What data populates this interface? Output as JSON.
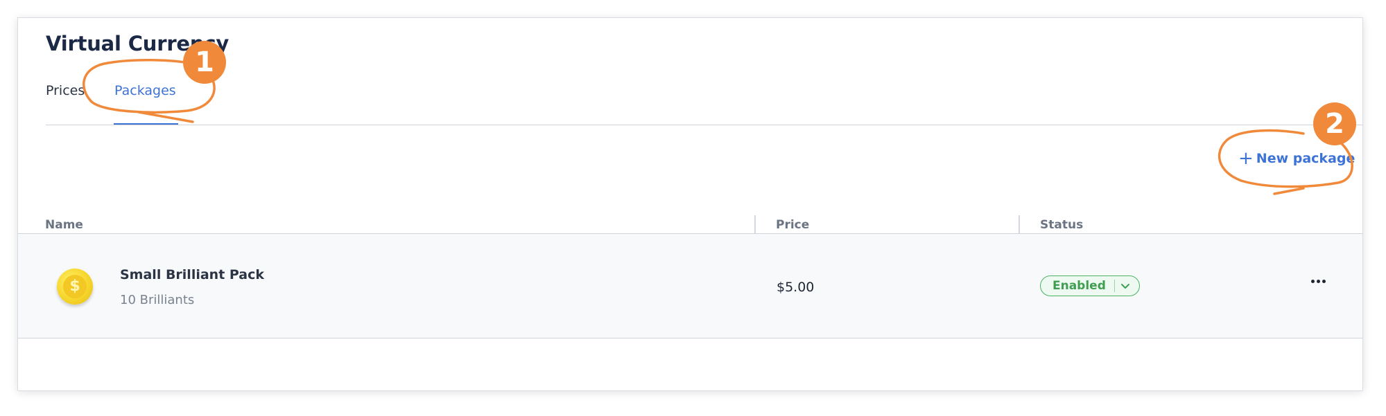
{
  "page": {
    "title": "Virtual Currency"
  },
  "tabs": [
    {
      "label": "Prices",
      "active": false
    },
    {
      "label": "Packages",
      "active": true
    }
  ],
  "toolbar": {
    "new_package_label": "New package",
    "new_package_icon": "plus-icon"
  },
  "table": {
    "columns": [
      "Name",
      "Price",
      "Status"
    ],
    "rows": [
      {
        "name": "Small Brilliant Pack",
        "subtitle": "10 Brilliants",
        "price": "$5.00",
        "status": "Enabled",
        "icon": "coin-icon"
      }
    ]
  },
  "annotations": {
    "badge_1": "1",
    "badge_2": "2",
    "color": "#f0893a"
  },
  "colors": {
    "accent": "#3d73d6",
    "status_enabled": "#3f9e52",
    "title": "#1b2946"
  }
}
